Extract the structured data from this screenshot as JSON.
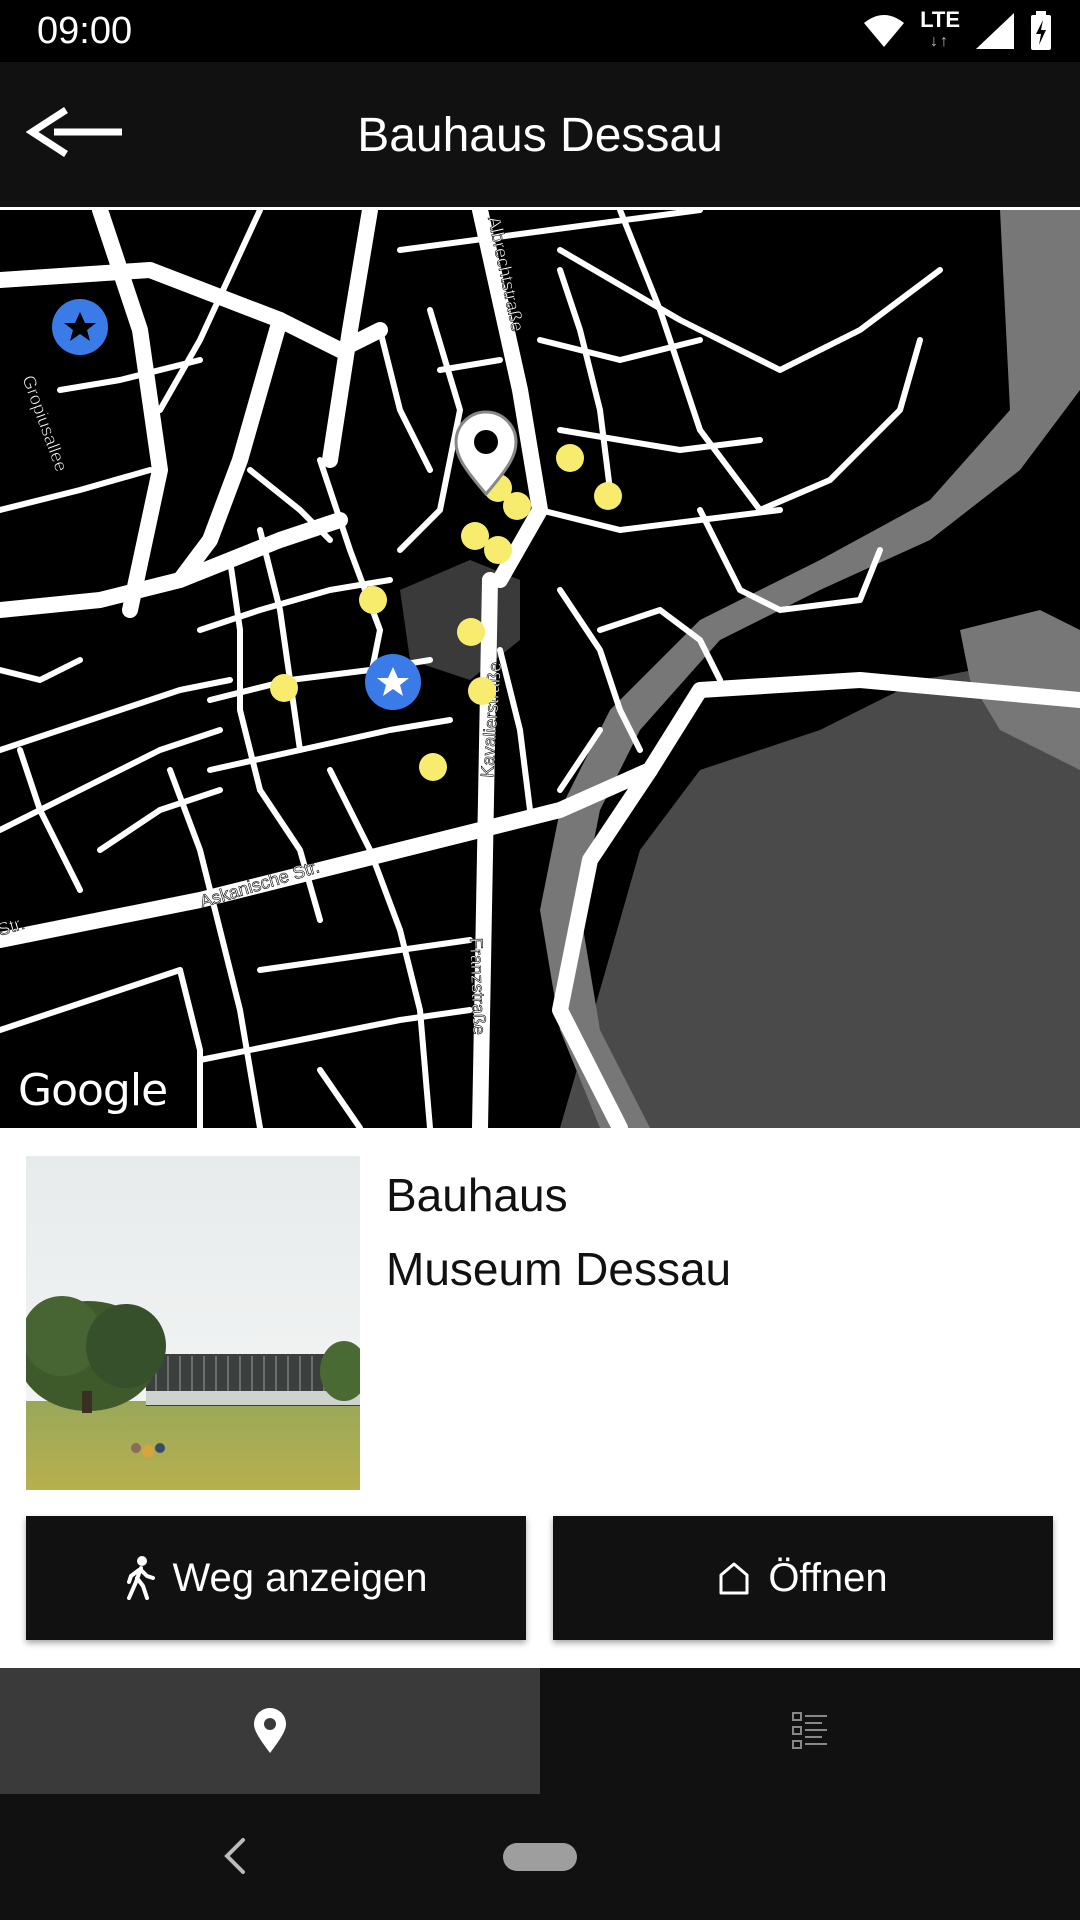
{
  "status": {
    "time": "09:00",
    "network": "LTE"
  },
  "app_bar": {
    "title": "Bauhaus Dessau"
  },
  "map": {
    "attribution": "Google",
    "street_labels": [
      "Albrechtstraße",
      "Gropiusallee",
      "Kavalierstraße",
      "Askanische Str.",
      "Franzstraße",
      "Str."
    ]
  },
  "place": {
    "title_line1": "Bauhaus",
    "title_line2": "Museum Dessau"
  },
  "buttons": {
    "route": "Weg anzeigen",
    "open": "Öffnen"
  },
  "colors": {
    "marker": "#f7ec6e",
    "star_marker": "#3a7be8",
    "bar": "#111111"
  }
}
